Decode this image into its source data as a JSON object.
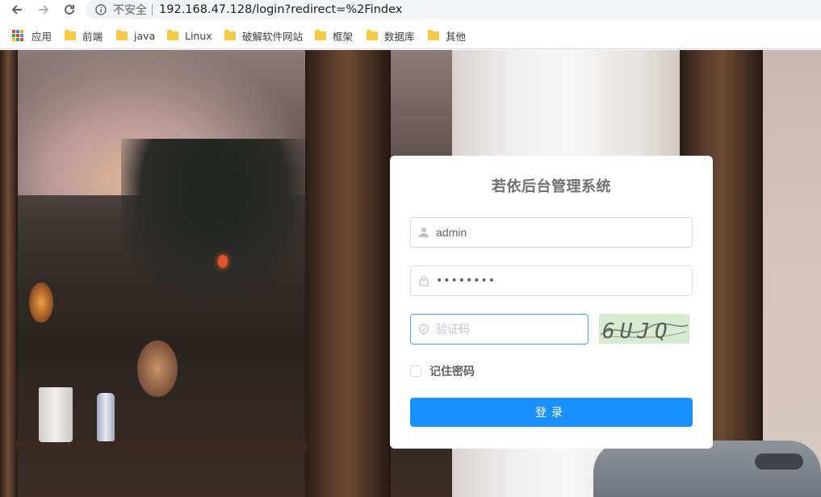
{
  "browser": {
    "security_label": "不安全",
    "url": "192.168.47.128/login?redirect=%2Findex"
  },
  "bookmarks": [
    {
      "label": "应用",
      "icon": "apps-grid-icon"
    },
    {
      "label": "前端",
      "icon": "folder-icon"
    },
    {
      "label": "java",
      "icon": "folder-icon"
    },
    {
      "label": "Linux",
      "icon": "folder-icon"
    },
    {
      "label": "破解软件网站",
      "icon": "folder-icon"
    },
    {
      "label": "框架",
      "icon": "folder-icon"
    },
    {
      "label": "数据库",
      "icon": "folder-icon"
    },
    {
      "label": "其他",
      "icon": "folder-icon"
    }
  ],
  "login": {
    "title": "若依后台管理系统",
    "username_value": "admin",
    "password_mask": "••••••••",
    "captcha_placeholder": "验证码",
    "captcha_text": "6UJQ",
    "remember_label": "记住密码",
    "submit_label": "登录"
  },
  "colors": {
    "primary": "#1890ff",
    "focus_border": "#409eff",
    "captcha_bg": "#d6ebd0"
  }
}
